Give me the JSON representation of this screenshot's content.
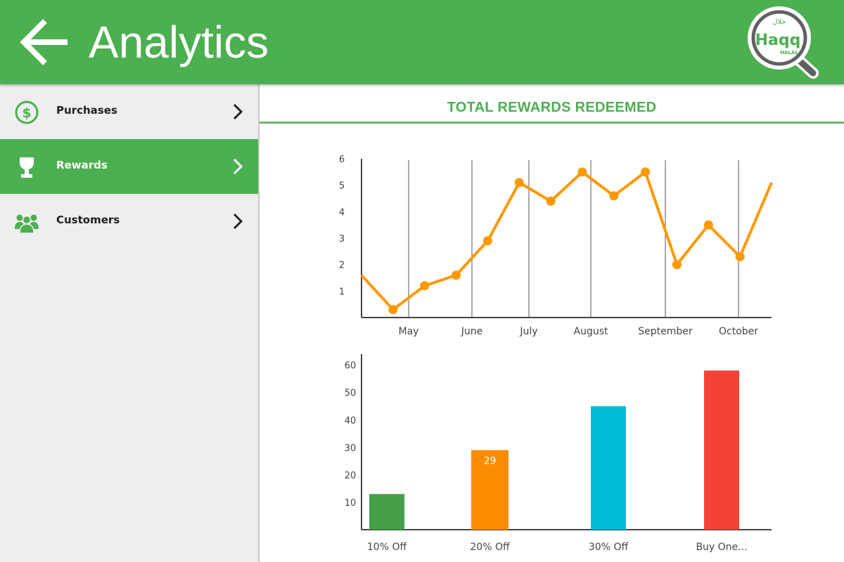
{
  "header": {
    "title": "Analytics",
    "logo_text": "Haqq",
    "logo_arabic": "حلال",
    "logo_subtext": "HALAL",
    "color": "#4caf50"
  },
  "sidebar": {
    "items": [
      {
        "label": "Purchases",
        "icon": "dollar-circle-icon",
        "active": false
      },
      {
        "label": "Rewards",
        "icon": "trophy-icon",
        "active": true
      },
      {
        "label": "Customers",
        "icon": "people-icon",
        "active": false
      }
    ]
  },
  "main": {
    "section_title": "TOTAL REWARDS REDEEMED"
  },
  "chart_data": [
    {
      "type": "line",
      "title": "",
      "xlabel": "",
      "ylabel": "",
      "x_tick_labels": [
        "May",
        "June",
        "July",
        "August",
        "September",
        "October"
      ],
      "y_ticks": [
        1,
        2,
        3,
        4,
        5,
        6
      ],
      "ylim": [
        0,
        6
      ],
      "values": [
        1.6,
        0.3,
        1.2,
        1.6,
        2.9,
        5.1,
        4.4,
        5.5,
        4.6,
        5.5,
        2.0,
        3.5,
        2.3,
        5.1
      ],
      "grid": "vertical lines at month ticks",
      "color": "#ff9800"
    },
    {
      "type": "bar",
      "title": "",
      "categories": [
        "10% Off",
        "20% Off",
        "30% Off",
        "Buy One..."
      ],
      "values": [
        13,
        29,
        45,
        58
      ],
      "data_labels": [
        "",
        "29",
        "",
        ""
      ],
      "y_ticks": [
        10,
        20,
        30,
        40,
        50,
        60
      ],
      "ylim": [
        0,
        64
      ],
      "colors": [
        "#43a047",
        "#fb8c00",
        "#00bcd4",
        "#f44336"
      ]
    }
  ]
}
